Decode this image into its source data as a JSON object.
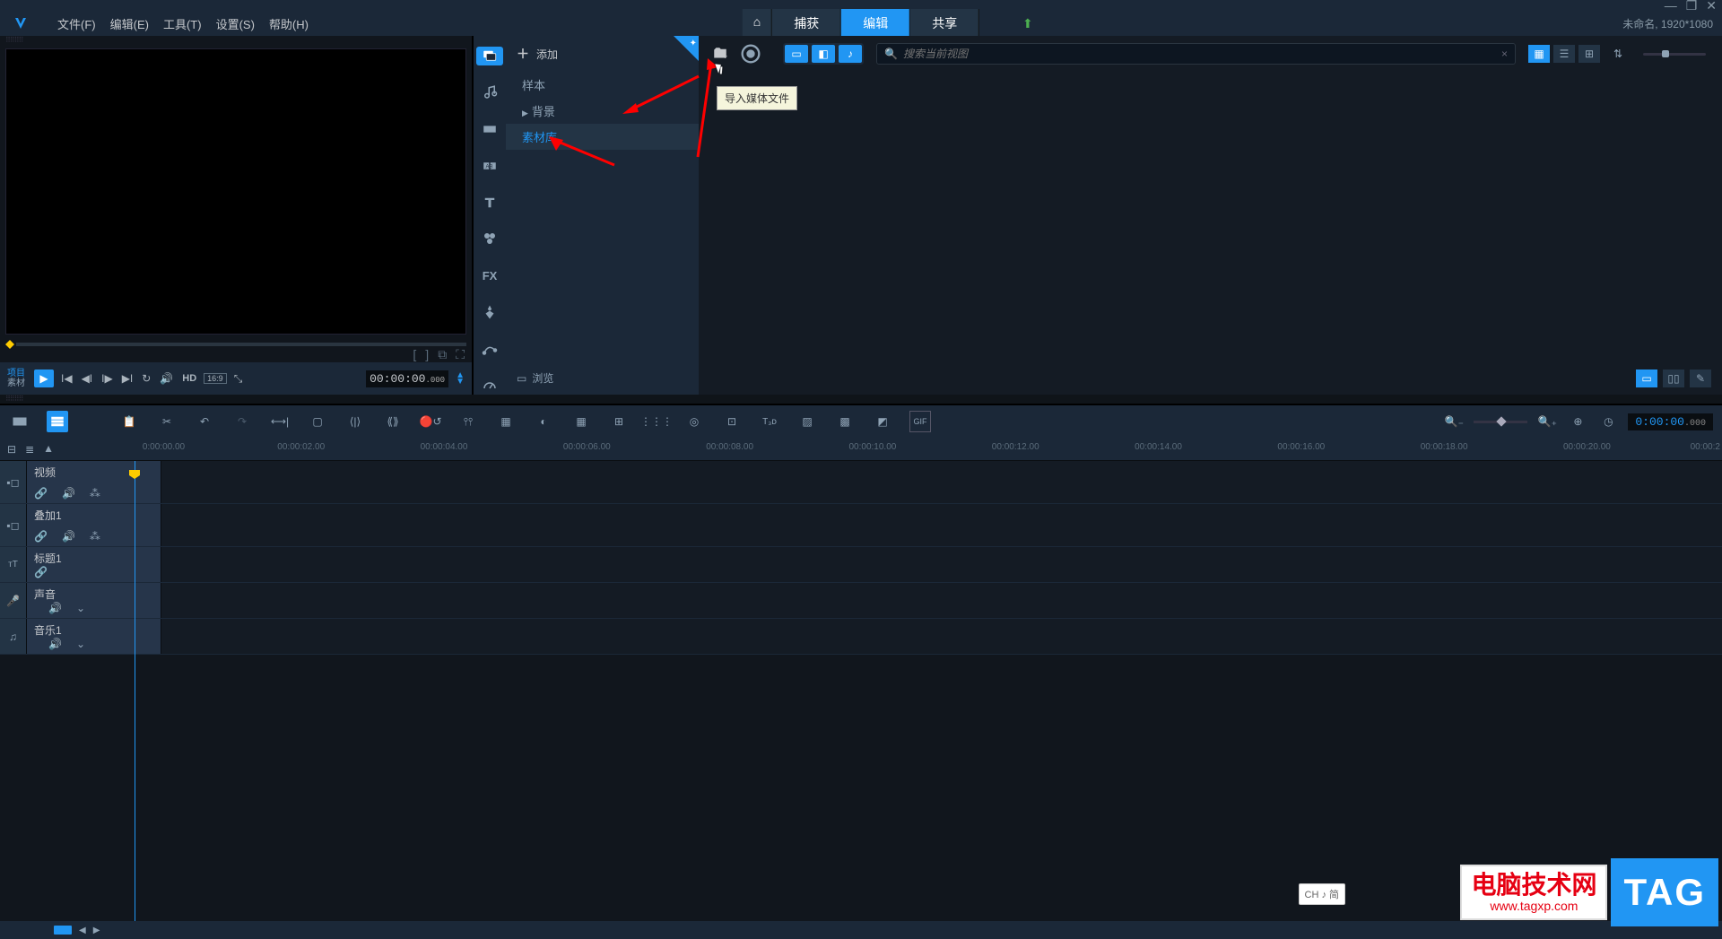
{
  "window": {
    "title_right": "未命名, 1920*1080"
  },
  "menubar": {
    "items": [
      "文件(F)",
      "编辑(E)",
      "工具(T)",
      "设置(S)",
      "帮助(H)"
    ],
    "tabs": {
      "home": "⌂",
      "capture": "捕获",
      "edit": "编辑",
      "share": "共享"
    }
  },
  "preview": {
    "mode_labels": {
      "proj": "项目",
      "clip": "素材"
    },
    "hd_label": "HD",
    "aspect_label": "16:9",
    "timecode": "00:00:00",
    "timecode_frames": ".000"
  },
  "library": {
    "add_label": "添加",
    "tree": {
      "sample": "样本",
      "background": "背景",
      "library": "素材库"
    },
    "browse_label": "浏览",
    "search_placeholder": "搜索当前视图",
    "tooltip": "导入媒体文件"
  },
  "timeline": {
    "timecode": "0:00:00",
    "timecode_frames": ".000",
    "ruler": [
      "0:00:00.00",
      "00:00:02.00",
      "00:00:04.00",
      "00:00:06.00",
      "00:00:08.00",
      "00:00:10.00",
      "00:00:12.00",
      "00:00:14.00",
      "00:00:16.00",
      "00:00:18.00",
      "00:00:20.00",
      "00:00:2"
    ],
    "tracks": {
      "video": "视频",
      "overlay": "叠加1",
      "title": "标题1",
      "voice": "声音",
      "music": "音乐1"
    }
  },
  "ime": "CH ♪ 简",
  "watermark": {
    "name": "电脑技术网",
    "url": "www.tagxp.com",
    "tag": "TAG"
  }
}
